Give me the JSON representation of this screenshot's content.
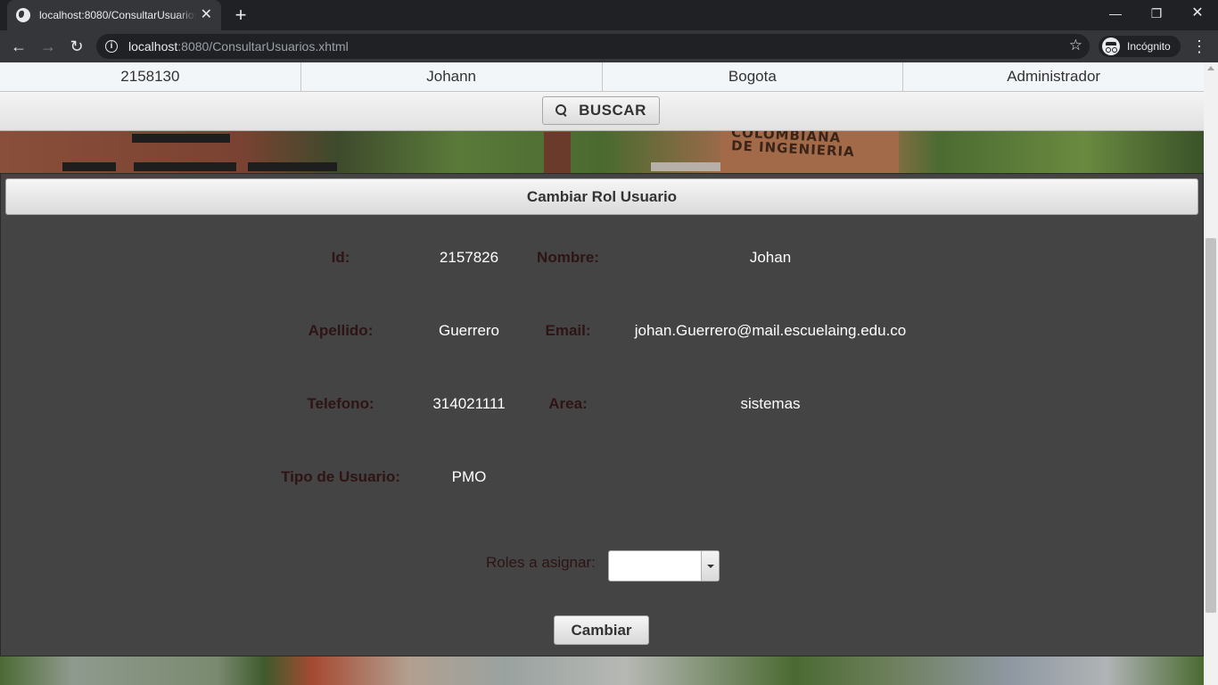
{
  "browser": {
    "tab_title": "localhost:8080/ConsultarUsuarios.xhtml",
    "url_host": "localhost",
    "url_rest": ":8080/ConsultarUsuarios.xhtml",
    "incognito_label": "Incógnito"
  },
  "results_row": [
    "2158130",
    "Johann",
    "Bogota",
    "Administrador"
  ],
  "search": {
    "button_label": "BUSCAR"
  },
  "background": {
    "sign_lines": [
      "COLOMBIANA",
      "DE INGENIERIA"
    ]
  },
  "dialog": {
    "title": "Cambiar Rol Usuario",
    "fields": {
      "id": {
        "label": "Id:",
        "value": "2157826"
      },
      "nombre": {
        "label": "Nombre:",
        "value": "Johan"
      },
      "apellido": {
        "label": "Apellido:",
        "value": "Guerrero"
      },
      "email": {
        "label": "Email:",
        "value": "johan.Guerrero@mail.escuelaing.edu.co"
      },
      "telefono": {
        "label": "Telefono:",
        "value": "314021111"
      },
      "area": {
        "label": "Area:",
        "value": "sistemas"
      },
      "tipo": {
        "label": "Tipo de Usuario:",
        "value": "PMO"
      }
    },
    "roles_label": "Roles a asignar:",
    "roles_selected": "",
    "submit_label": "Cambiar"
  },
  "colors": {
    "panel_bg": "#444444",
    "label_color": "#2e1414",
    "value_color": "#ffffff"
  }
}
